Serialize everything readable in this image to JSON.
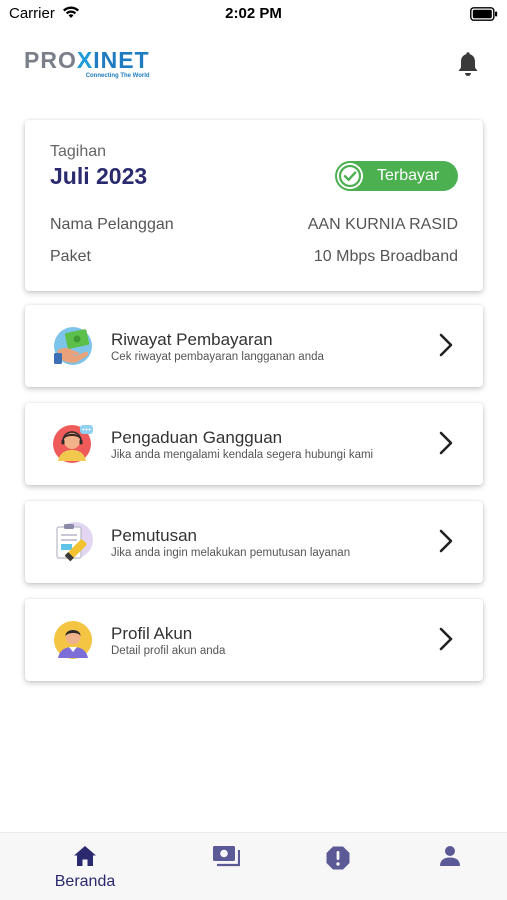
{
  "status_bar": {
    "carrier": "Carrier",
    "time": "2:02 PM"
  },
  "header": {
    "logo_text_1": "PRO",
    "logo_text_x": "X",
    "logo_text_2": "INET",
    "tagline": "Connecting The World",
    "notification_icon": "bell-icon"
  },
  "bill": {
    "label": "Tagihan",
    "period": "Juli 2023",
    "status": "Terbayar",
    "status_color": "#4caf50",
    "customer_label": "Nama Pelanggan",
    "customer_value": "AAN KURNIA RASID",
    "package_label": "Paket",
    "package_value": "10 Mbps Broadband"
  },
  "menu": [
    {
      "title": "Riwayat Pembayaran",
      "subtitle": "Cek riwayat pembayaran langganan anda",
      "icon": "payment-history-icon"
    },
    {
      "title": "Pengaduan Gangguan",
      "subtitle": "Jika anda mengalami kendala segera hubungi kami",
      "icon": "complaint-agent-icon"
    },
    {
      "title": "Pemutusan",
      "subtitle": "Jika anda ingin melakukan pemutusan layanan",
      "icon": "termination-document-icon"
    },
    {
      "title": "Profil Akun",
      "subtitle": "Detail profil akun anda",
      "icon": "profile-avatar-icon"
    }
  ],
  "bottom_nav": [
    {
      "label": "Beranda",
      "icon": "home-icon",
      "active": true
    },
    {
      "label": "",
      "icon": "payment-icon",
      "active": false
    },
    {
      "label": "",
      "icon": "alert-icon",
      "active": false
    },
    {
      "label": "",
      "icon": "user-icon",
      "active": false
    }
  ],
  "colors": {
    "primary": "#2b2a6e",
    "nav_icon": "#5b5a96",
    "success": "#4caf50"
  }
}
